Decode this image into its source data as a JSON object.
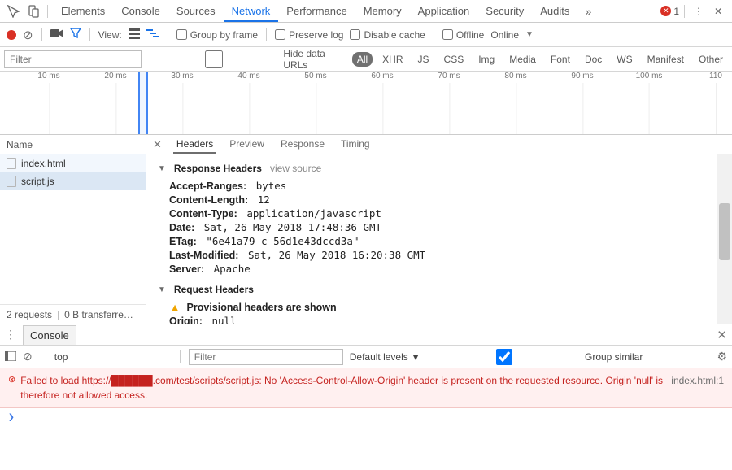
{
  "topTabs": {
    "items": [
      "Elements",
      "Console",
      "Sources",
      "Network",
      "Performance",
      "Memory",
      "Application",
      "Security",
      "Audits"
    ],
    "active": 3,
    "errorCount": "1"
  },
  "toolbar": {
    "viewLabel": "View:",
    "groupByFrame": "Group by frame",
    "preserveLog": "Preserve log",
    "disableCache": "Disable cache",
    "offline": "Offline",
    "online": "Online"
  },
  "filterRow": {
    "placeholder": "Filter",
    "hideDataUrls": "Hide data URLs",
    "types": [
      "All",
      "XHR",
      "JS",
      "CSS",
      "Img",
      "Media",
      "Font",
      "Doc",
      "WS",
      "Manifest",
      "Other"
    ],
    "activeType": 0
  },
  "timeline": {
    "ticks": [
      "10 ms",
      "20 ms",
      "30 ms",
      "40 ms",
      "50 ms",
      "60 ms",
      "70 ms",
      "80 ms",
      "90 ms",
      "100 ms",
      "110"
    ]
  },
  "requests": {
    "columnHeader": "Name",
    "items": [
      "index.html",
      "script.js"
    ],
    "selected": 1,
    "status": {
      "count": "2 requests",
      "transfer": "0 B transferre…"
    }
  },
  "detail": {
    "tabs": [
      "Headers",
      "Preview",
      "Response",
      "Timing"
    ],
    "activeTab": 0,
    "responseHeadersTitle": "Response Headers",
    "viewSource": "view source",
    "responseHeaders": [
      {
        "k": "Accept-Ranges:",
        "v": "bytes"
      },
      {
        "k": "Content-Length:",
        "v": "12"
      },
      {
        "k": "Content-Type:",
        "v": "application/javascript"
      },
      {
        "k": "Date:",
        "v": "Sat, 26 May 2018 17:48:36 GMT"
      },
      {
        "k": "ETag:",
        "v": "\"6e41a79-c-56d1e43dccd3a\""
      },
      {
        "k": "Last-Modified:",
        "v": "Sat, 26 May 2018 16:20:38 GMT"
      },
      {
        "k": "Server:",
        "v": "Apache"
      }
    ],
    "requestHeadersTitle": "Request Headers",
    "provisional": "Provisional headers are shown",
    "requestHeaders": [
      {
        "k": "Origin:",
        "v": "null"
      }
    ]
  },
  "consoleHdr": {
    "tab": "Console"
  },
  "consoleTool": {
    "context": "top",
    "filterPlaceholder": "Filter",
    "levels": "Default levels",
    "groupSimilar": "Group similar"
  },
  "consoleMsg": {
    "prefix": "Failed to load ",
    "url": "https://██████.com/test/scripts/script.js",
    "rest": ": No 'Access-Control-Allow-Origin' header is present on the requested resource. Origin 'null' is therefore not allowed access.",
    "source": "index.html:1"
  },
  "prompt": "❯"
}
